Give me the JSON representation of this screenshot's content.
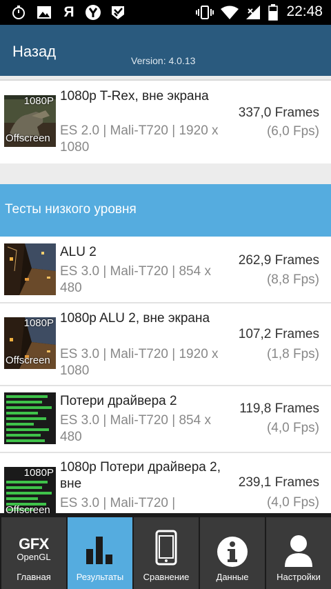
{
  "status_bar": {
    "time": "22:48",
    "left_icons": [
      "stopwatch-icon",
      "image-icon",
      "yandex-icon",
      "yandex-browser-icon",
      "check-badge-icon"
    ],
    "right_icons": [
      "vibrate-icon",
      "wifi-icon",
      "signal-icon",
      "battery-icon"
    ],
    "yandex_letter": "Я"
  },
  "header": {
    "back_label": "Назад",
    "version": "Version: 4.0.13"
  },
  "results": [
    {
      "name": "1080p T-Rex, вне экрана",
      "details": "ES 2.0 | Mali-T720 | 1920 x 1080",
      "frames": "337,0 Frames",
      "fps": "(6,0 Fps)",
      "badge_top": "1080P",
      "badge_bottom": "Offscreen"
    }
  ],
  "section": {
    "title": "Тесты низкого уровня"
  },
  "low_level_results": [
    {
      "name": "ALU 2",
      "details": "ES 3.0 | Mali-T720 | 854 x 480",
      "frames": "262,9 Frames",
      "fps": "(8,8 Fps)"
    },
    {
      "name": "1080p ALU 2, вне экрана",
      "details": "ES 3.0 | Mali-T720 | 1920 x 1080",
      "frames": "107,2 Frames",
      "fps": "(1,8 Fps)",
      "badge_top": "1080P",
      "badge_bottom": "Offscreen"
    },
    {
      "name": "Потери драйвера 2",
      "details": "ES 3.0 | Mali-T720 | 854 x 480",
      "frames": "119,8 Frames",
      "fps": "(4,0 Fps)"
    },
    {
      "name": "1080p Потери драйвера 2, вне",
      "details": "ES 3.0 | Mali-T720 |",
      "frames": "239,1 Frames",
      "fps": "(4,0 Fps)",
      "badge_top": "1080P",
      "badge_bottom": "Offscreen"
    }
  ],
  "nav": {
    "items": [
      {
        "label": "Главная",
        "icon": "gfx-opengl-logo",
        "logo_top": "GFX",
        "logo_bottom": "OpenGL",
        "active": false
      },
      {
        "label": "Результаты",
        "icon": "bar-chart-icon",
        "active": true
      },
      {
        "label": "Сравнение",
        "icon": "phone-icon",
        "active": false
      },
      {
        "label": "Данные",
        "icon": "info-icon",
        "active": false
      },
      {
        "label": "Настройки",
        "icon": "user-icon",
        "active": false
      }
    ]
  },
  "colors": {
    "header_bg": "#2a5a7e",
    "section_bg": "#55acdf",
    "nav_active": "#55acdf",
    "nav_bg": "#3a3a3a"
  }
}
